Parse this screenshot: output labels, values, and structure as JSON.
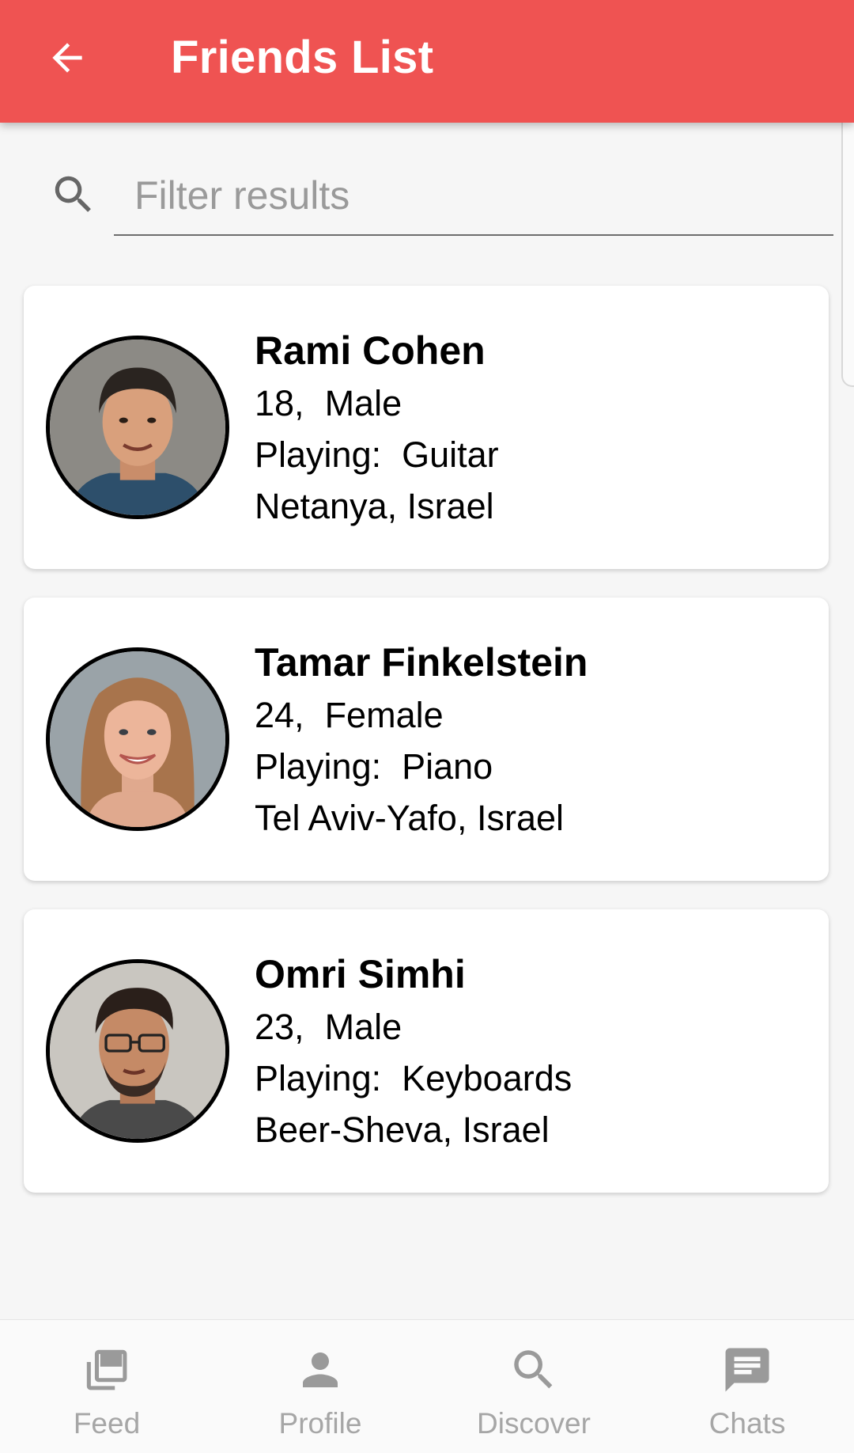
{
  "appbar": {
    "title": "Friends List",
    "color": "#ef5352",
    "back_icon": "arrow-back-icon"
  },
  "search": {
    "placeholder": "Filter results",
    "value": "",
    "icon": "search-icon"
  },
  "friends": [
    {
      "name": "Rami Cohen",
      "age": "18,",
      "gender": "Male",
      "playing_label": "Playing:",
      "instrument": "Guitar",
      "location": "Netanya, Israel",
      "avatar": "rami-cohen-avatar"
    },
    {
      "name": "Tamar Finkelstein",
      "age": "24,",
      "gender": "Female",
      "playing_label": "Playing:",
      "instrument": "Piano",
      "location": "Tel Aviv-Yafo, Israel",
      "avatar": "tamar-finkelstein-avatar"
    },
    {
      "name": "Omri Simhi",
      "age": "23,",
      "gender": "Male",
      "playing_label": "Playing:",
      "instrument": "Keyboards",
      "location": "Beer-Sheva, Israel",
      "avatar": "omri-simhi-avatar"
    }
  ],
  "bottom_nav": [
    {
      "label": "Feed",
      "icon": "feed-icon"
    },
    {
      "label": "Profile",
      "icon": "person-icon"
    },
    {
      "label": "Discover",
      "icon": "search-icon"
    },
    {
      "label": "Chats",
      "icon": "chat-icon"
    }
  ]
}
